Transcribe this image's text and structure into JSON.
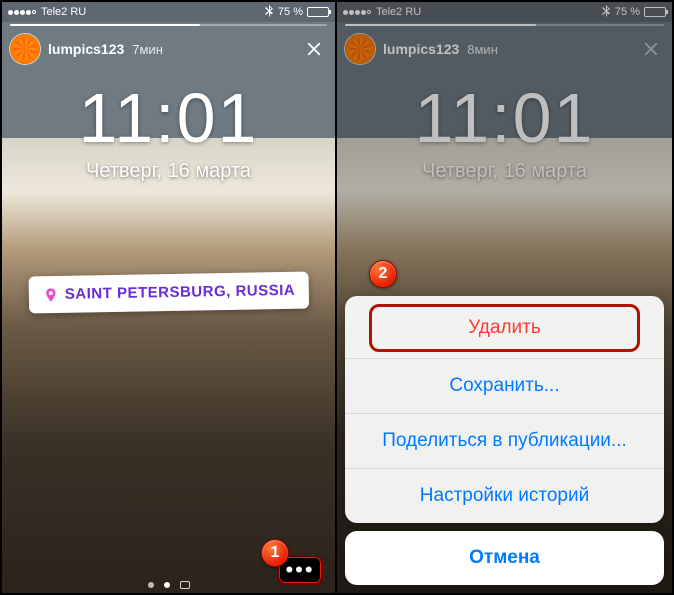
{
  "status": {
    "carrier": "Tele2 RU",
    "bt_icon": "bt",
    "battery_pct": "75 %"
  },
  "left": {
    "username": "lumpics123",
    "time_ago": "7мин",
    "lock_time": "11:01",
    "lock_date": "Четверг, 16 марта",
    "geo_label": "SAINT PETERSBURG, RUSSIA",
    "badge": "1"
  },
  "right": {
    "username": "lumpics123",
    "time_ago": "8мин",
    "lock_time": "11:01",
    "lock_date": "Четверг, 16 марта",
    "badge": "2",
    "sheet": {
      "delete": "Удалить",
      "save": "Сохранить...",
      "share": "Поделиться в публикации...",
      "settings": "Настройки историй",
      "cancel": "Отмена"
    }
  }
}
